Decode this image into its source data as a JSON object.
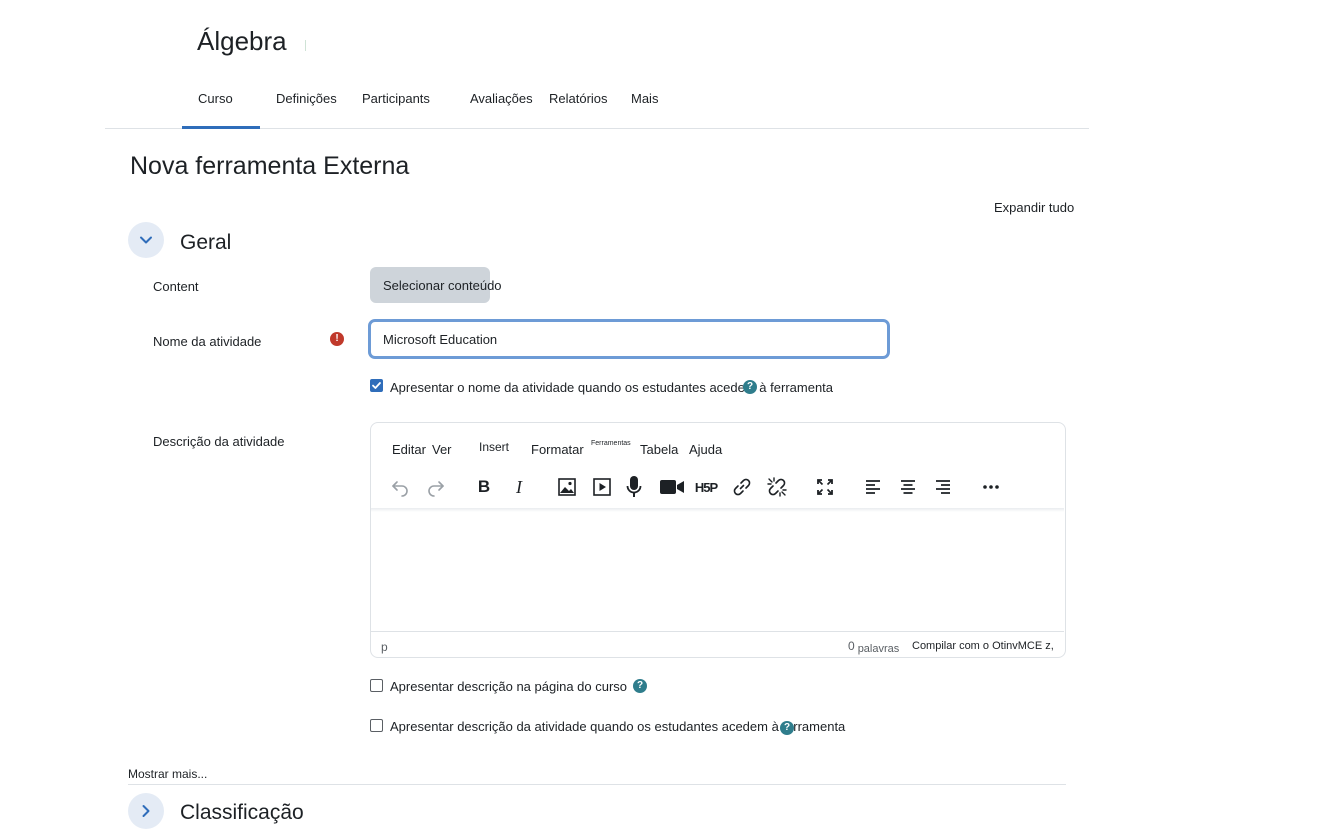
{
  "course": {
    "title": "Álgebra"
  },
  "nav": {
    "tabs": [
      {
        "label": "Curso",
        "active": true
      },
      {
        "label": "Definições"
      },
      {
        "label": "Participants"
      },
      {
        "label": "Avaliações"
      },
      {
        "label": "Relatórios"
      },
      {
        "label": "Mais"
      }
    ]
  },
  "page": {
    "title": "Nova ferramenta Externa",
    "expand_all": "Expandir tudo"
  },
  "sections": {
    "general": {
      "title": "Geral"
    },
    "grading": {
      "title": "Classificação"
    }
  },
  "form": {
    "content": {
      "label": "Content",
      "button": "Selecionar conteúdo"
    },
    "activity_name": {
      "label": "Nome da atividade",
      "value": "Microsoft Education",
      "required_icon": "!"
    },
    "show_name": {
      "label": "Apresentar o nome da atividade quando os estudantes acedem à ferramenta",
      "checked": true
    },
    "description": {
      "label": "Descrição da atividade"
    },
    "show_description_course": {
      "label": "Apresentar descrição na página do curso",
      "checked": false
    },
    "show_description_tool": {
      "label": "Apresentar descrição da atividade quando os estudantes acedem à ferramenta",
      "checked": false
    }
  },
  "editor": {
    "menu": [
      "Editar",
      "Ver",
      "Insert",
      "Formatar",
      "Ferramentas",
      "Tabela",
      "Ajuda"
    ],
    "toolbar": [
      "undo-icon",
      "redo-icon",
      "bold-icon",
      "italic-icon",
      "image-icon",
      "media-icon",
      "microphone-icon",
      "video-camera-icon",
      "h5p-icon",
      "link-icon",
      "unlink-icon",
      "fullscreen-icon",
      "align-left-icon",
      "align-center-icon",
      "align-right-icon",
      "more-icon"
    ],
    "bold_glyph": "B",
    "italic_glyph": "I",
    "h5p_text": "H5P",
    "status": {
      "element_path": "p",
      "word_count": "0",
      "words_label": "palavras",
      "brand": "Compilar com o OtinvMCE z,"
    }
  },
  "help_icon_glyph": "?",
  "footer": {
    "show_more": "Mostrar mais..."
  },
  "colors": {
    "accent": "#2f6dba",
    "help": "#2f7d8c",
    "required": "#c0392b",
    "button_bg": "#ced4da"
  }
}
